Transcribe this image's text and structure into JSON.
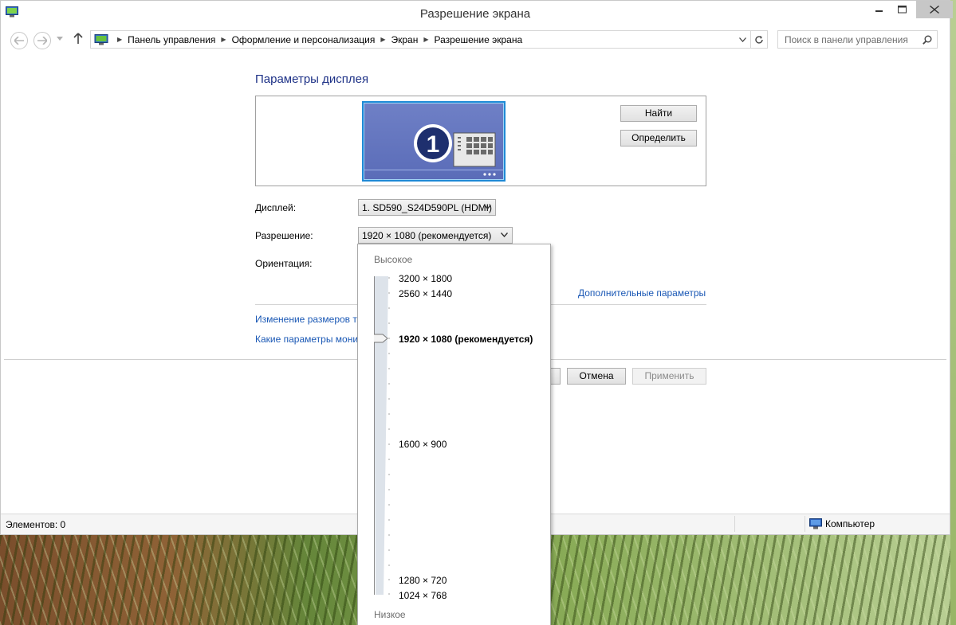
{
  "window": {
    "title": "Разрешение экрана"
  },
  "address": {
    "breadcrumbs": [
      "Панель управления",
      "Оформление и персонализация",
      "Экран",
      "Разрешение экрана"
    ],
    "search_placeholder": "Поиск в панели управления"
  },
  "content": {
    "heading": "Параметры дисплея",
    "find_button": "Найти",
    "identify_button": "Определить",
    "monitor_number": "1",
    "display_label": "Дисплей:",
    "display_value": "1. SD590_S24D590PL (HDMI)",
    "resolution_label": "Разрешение:",
    "resolution_value": "1920 × 1080 (рекомендуется)",
    "orientation_label": "Ориентация:",
    "advanced_link": "Дополнительные параметры",
    "link_text_size": "Изменение размеров те",
    "link_monitor": "Какие параметры мони",
    "cancel_button": "Отмена",
    "apply_button": "Применить"
  },
  "resolution_popup": {
    "high_label": "Высокое",
    "low_label": "Низкое",
    "options": [
      {
        "label": "3200 × 1800"
      },
      {
        "label": "2560 × 1440"
      },
      {
        "label": "1920 × 1080 (рекомендуется)",
        "selected": true
      },
      {
        "label": "1600 × 900"
      },
      {
        "label": "1280 × 720"
      },
      {
        "label": "1024 × 768"
      }
    ]
  },
  "statusbar": {
    "items_count": "Элементов: 0",
    "location": "Компьютер"
  },
  "colors": {
    "link": "#1a58b5",
    "heading": "#1e3287",
    "monitor_border": "#1f8ad6"
  }
}
